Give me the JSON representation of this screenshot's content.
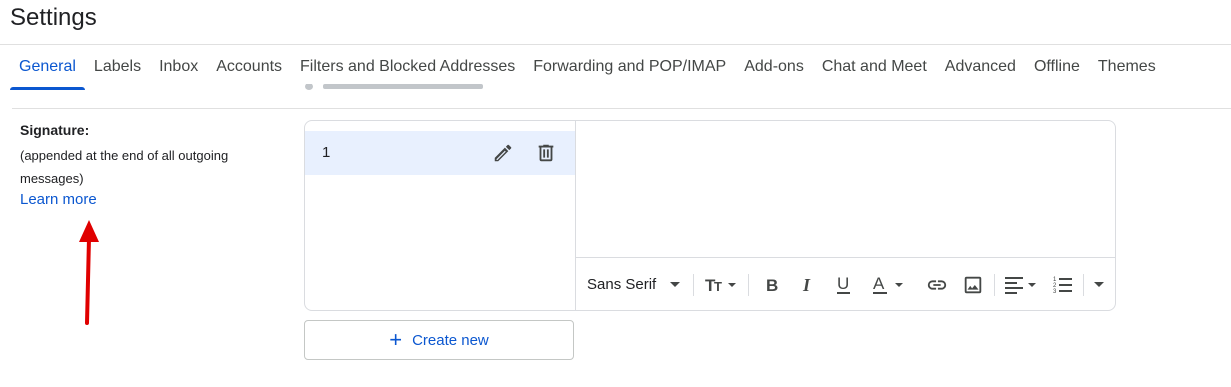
{
  "header": {
    "title": "Settings"
  },
  "tabs": [
    {
      "label": "General",
      "active": true
    },
    {
      "label": "Labels"
    },
    {
      "label": "Inbox"
    },
    {
      "label": "Accounts"
    },
    {
      "label": "Filters and Blocked Addresses"
    },
    {
      "label": "Forwarding and POP/IMAP"
    },
    {
      "label": "Add-ons"
    },
    {
      "label": "Chat and Meet"
    },
    {
      "label": "Advanced"
    },
    {
      "label": "Offline"
    },
    {
      "label": "Themes"
    }
  ],
  "signature": {
    "title": "Signature:",
    "description": "(appended at the end of all outgoing messages)",
    "learn_more": "Learn more",
    "items": [
      {
        "name": "1"
      }
    ],
    "create_new": "Create new"
  },
  "toolbar": {
    "font": "Sans Serif",
    "icons": [
      "dropdown-caret-icon",
      "text-size-icon",
      "bold-icon",
      "italic-icon",
      "underline-icon",
      "text-color-icon",
      "link-icon",
      "image-icon",
      "align-icon",
      "numbered-list-icon",
      "more-formatting-icon"
    ]
  },
  "colors": {
    "accent": "#0b57d0",
    "selected_row": "#e8f0fe",
    "arrow": "#e00000"
  }
}
